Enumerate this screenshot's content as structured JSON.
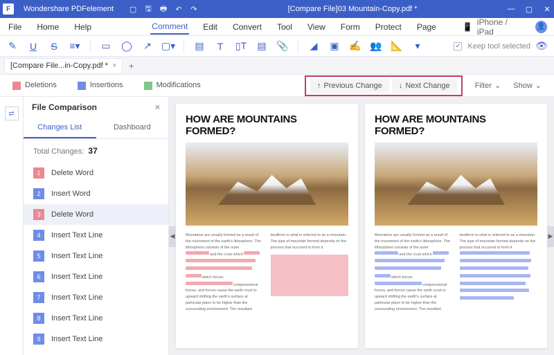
{
  "titlebar": {
    "app": "Wondershare PDFelement",
    "doc": "[Compare File]03 Mountain-Copy.pdf *"
  },
  "menu": {
    "file": "File",
    "home": "Home",
    "help": "Help",
    "comment": "Comment",
    "edit": "Edit",
    "convert": "Convert",
    "tool": "Tool",
    "view": "View",
    "form": "Form",
    "protect": "Protect",
    "page": "Page",
    "device": "iPhone / iPad"
  },
  "toolbar": {
    "keep": "Keep tool selected"
  },
  "tab": {
    "name": "[Compare  File...in-Copy.pdf *"
  },
  "legend": {
    "del": "Deletions",
    "ins": "Insertions",
    "mod": "Modifications",
    "prev": "Previous Change",
    "next": "Next Change",
    "filter": "Filter",
    "show": "Show"
  },
  "panel": {
    "title": "File Comparison",
    "changes": "Changes List",
    "dash": "Dashboard",
    "totalLabel": "Total Changes:",
    "total": "37"
  },
  "changes": [
    {
      "n": "1",
      "t": "Delete Word",
      "c": "red"
    },
    {
      "n": "2",
      "t": "Insert Word",
      "c": "blue"
    },
    {
      "n": "3",
      "t": "Delete Word",
      "c": "red",
      "active": true
    },
    {
      "n": "4",
      "t": "Insert Text Line",
      "c": "blue"
    },
    {
      "n": "5",
      "t": "Insert Text Line",
      "c": "blue"
    },
    {
      "n": "6",
      "t": "Insert Text Line",
      "c": "blue"
    },
    {
      "n": "7",
      "t": "Insert Text Line",
      "c": "blue"
    },
    {
      "n": "8",
      "t": "Insert Text Line",
      "c": "blue"
    },
    {
      "n": "9",
      "t": "Insert Text Line",
      "c": "blue"
    }
  ],
  "doc": {
    "heading": "HOW ARE MOUNTAINS FORMED?",
    "p1": "Mountains are usually formed as a result of the movement of the earth's lithosphere. The lithosphere consists of the outer",
    "p1b": "and the crust which",
    "p1c": "which forces",
    "p1d": "compressional forces, and forces cause the earth crust to upward shifting the earth's surface at particular place to be higher than the surrounding environment. The resultant",
    "p2": "landform is what is referred to as a mountain. The type of mountain formed depends on the process that occurred to form it."
  }
}
